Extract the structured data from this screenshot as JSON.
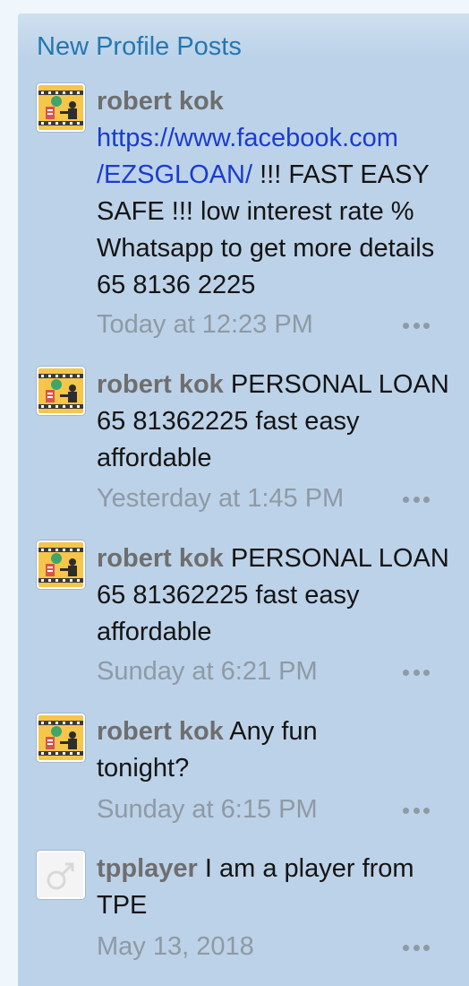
{
  "block": {
    "title": "New Profile Posts"
  },
  "posts": [
    {
      "username": "robert kok",
      "link": "https://www.facebook.com/EZSGLOAN/",
      "link_line1": "https://www.facebook.com",
      "link_line2": "/EZSGLOAN/",
      "message": " !!! FAST EASY SAFE !!! low interest rate % Whatsapp to get more details 65 8136 2225",
      "time": "Today at 12:23 PM",
      "avatar_icon": "money-bag-avatar-icon"
    },
    {
      "username": "robert kok",
      "message": " PERSONAL LOAN 65 81362225 fast easy affordable",
      "time": "Yesterday at 1:45 PM",
      "avatar_icon": "money-bag-avatar-icon"
    },
    {
      "username": "robert kok",
      "message": " PERSONAL LOAN 65 81362225 fast easy affordable",
      "time": "Sunday at 6:21 PM",
      "avatar_icon": "money-bag-avatar-icon"
    },
    {
      "username": "robert kok",
      "message": " Any fun tonight?",
      "time": "Sunday at 6:15 PM",
      "avatar_icon": "money-bag-avatar-icon"
    },
    {
      "username": "tpplayer",
      "message": " I am a player from TPE",
      "time": "May 13, 2018",
      "avatar_icon": "male-symbol-avatar-icon"
    }
  ],
  "colors": {
    "panel": "#bcd2e8",
    "title": "#2577b1",
    "link": "#1a3ccf",
    "username": "#6e6e6e",
    "meta": "#8e9aa4"
  }
}
